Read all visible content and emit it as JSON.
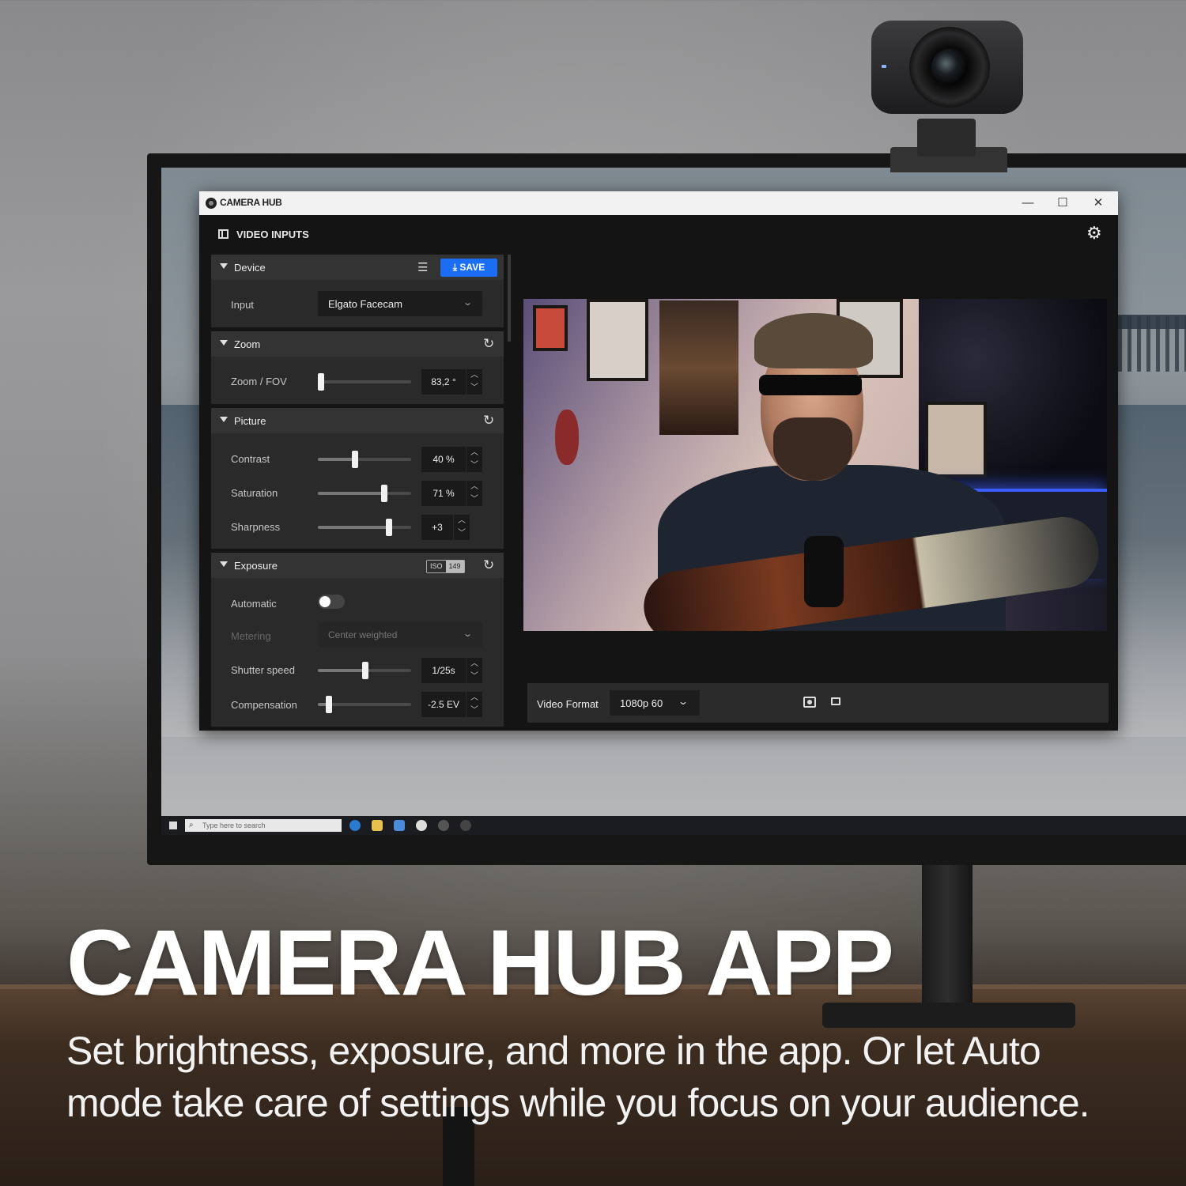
{
  "app": {
    "title": "CAMERA HUB",
    "window_controls": {
      "minimize": "—",
      "maximize": "☐",
      "close": "✕"
    },
    "page_title": "VIDEO INPUTS",
    "settings_icon": "gear-icon"
  },
  "device": {
    "title": "Device",
    "save_label": "SAVE",
    "input_label": "Input",
    "input_value": "Elgato Facecam"
  },
  "zoom": {
    "title": "Zoom",
    "fov_label": "Zoom / FOV",
    "fov_value": "83,2 °",
    "fov_level": 0.03
  },
  "picture": {
    "title": "Picture",
    "contrast_label": "Contrast",
    "contrast_value": "40 %",
    "contrast_level": 0.4,
    "saturation_label": "Saturation",
    "saturation_value": "71 %",
    "saturation_level": 0.71,
    "sharpness_label": "Sharpness",
    "sharpness_value": "+3",
    "sharpness_level": 0.76
  },
  "exposure": {
    "title": "Exposure",
    "iso_label": "ISO",
    "iso_value": "149",
    "automatic_label": "Automatic",
    "automatic_on": false,
    "metering_label": "Metering",
    "metering_value": "Center weighted",
    "shutter_label": "Shutter speed",
    "shutter_value": "1/25s",
    "shutter_level": 0.51,
    "compensation_label": "Compensation",
    "compensation_value": "-2.5 EV",
    "compensation_level": 0.12
  },
  "preview_bar": {
    "format_label": "Video Format",
    "format_value": "1080p 60"
  },
  "taskbar": {
    "search_placeholder": "Type here to search"
  },
  "marketing": {
    "headline": "CAMERA HUB APP",
    "subline": "Set brightness, exposure, and more in the app. Or let Auto mode take care of settings while you focus on your audience."
  },
  "colors": {
    "accent": "#1b6ef3",
    "panel": "#2a2a2a",
    "window": "#141414"
  }
}
